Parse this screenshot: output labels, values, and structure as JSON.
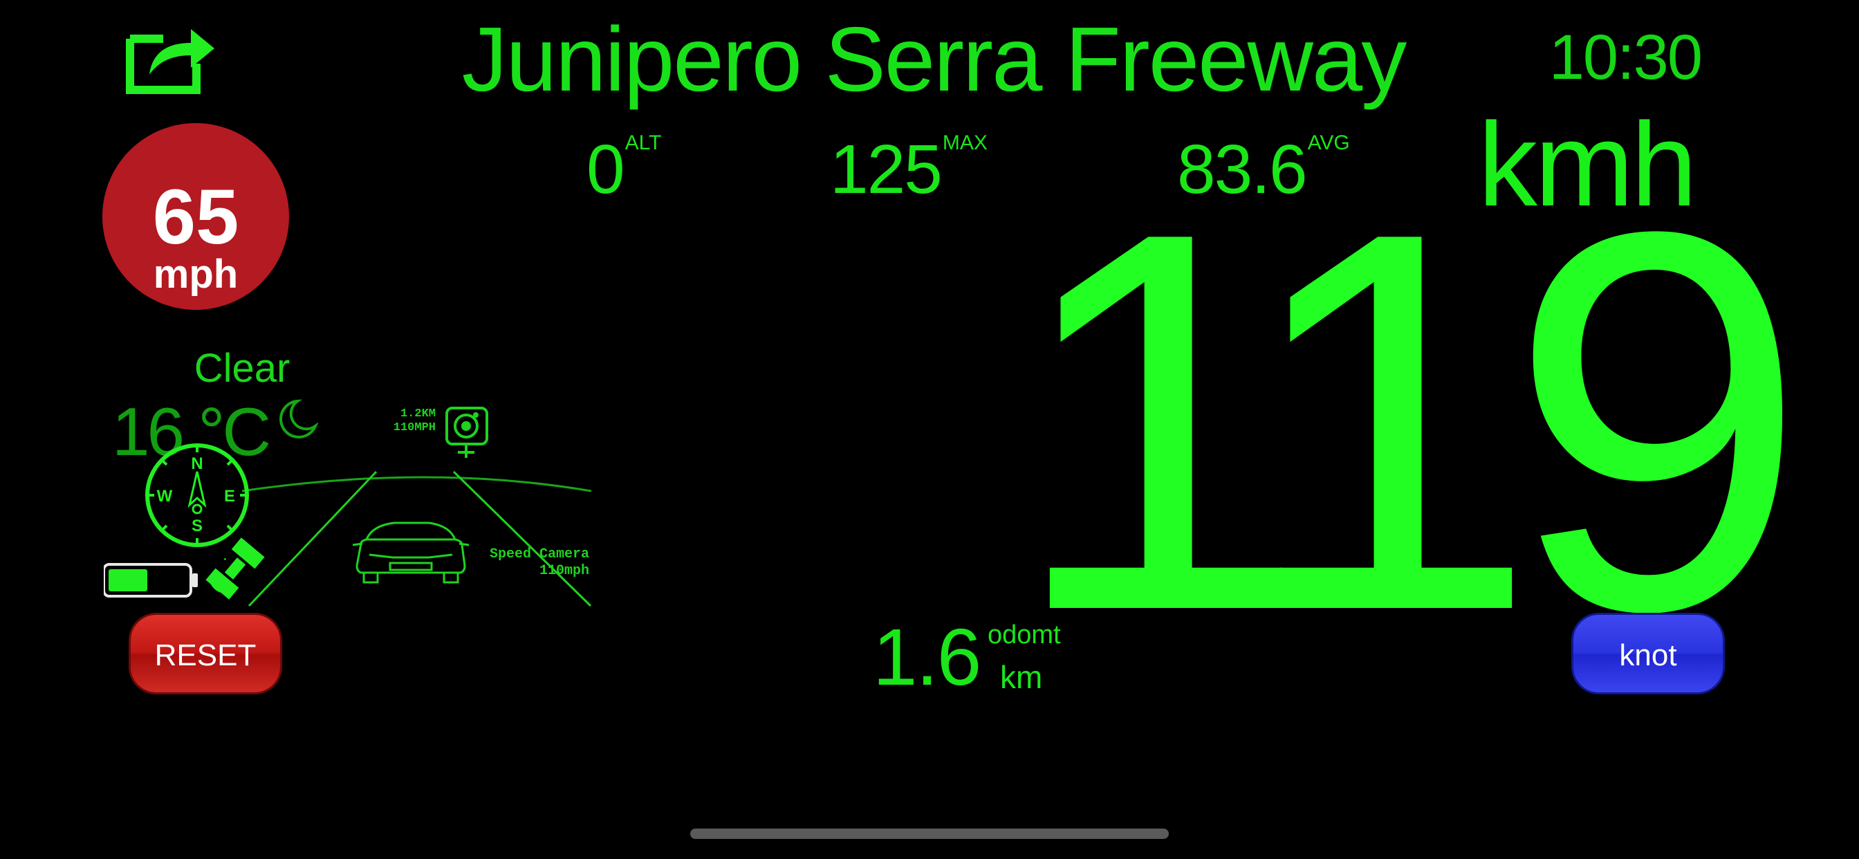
{
  "header": {
    "street_name": "Junipero Serra Freeway",
    "clock": "10:30"
  },
  "stats": {
    "altitude": {
      "value": "0",
      "label": "ALT"
    },
    "max": {
      "value": "125",
      "label": "MAX"
    },
    "average": {
      "value": "83.6",
      "label": "AVG"
    }
  },
  "speed": {
    "value": "119",
    "unit": "kmh"
  },
  "speed_limit": {
    "value": "65",
    "unit": "mph"
  },
  "weather": {
    "condition": "Clear",
    "temperature": "16 °C",
    "icon": "moon-icon"
  },
  "road_view": {
    "camera_distance": "1.2KM",
    "camera_limit": "110MPH",
    "camera_label": "Speed Camera",
    "camera_label_limit": "110mph",
    "compass": {
      "n": "N",
      "s": "S",
      "e": "E",
      "w": "W"
    },
    "battery_level": 0.5
  },
  "odometer": {
    "value": "1.6",
    "label": "odomt",
    "unit": "km"
  },
  "buttons": {
    "reset": "RESET",
    "unit_toggle": "knot"
  },
  "colors": {
    "accent_green": "#1aef1a",
    "limit_red": "#b41a22",
    "reset_red": "#c01814",
    "knot_blue": "#2a34e0"
  }
}
